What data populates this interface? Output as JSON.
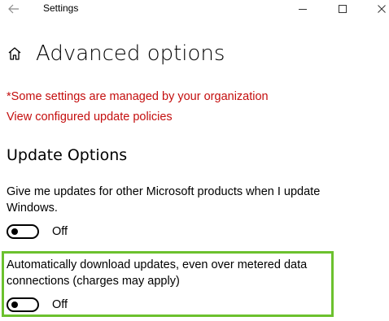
{
  "window": {
    "title": "Settings",
    "back_icon": "back-arrow-icon",
    "controls": [
      "minimize-icon",
      "maximize-icon",
      "close-icon"
    ]
  },
  "page": {
    "title": "Advanced options",
    "home_icon": "home-icon"
  },
  "notices": {
    "org_warning": "*Some settings are managed by your organization",
    "policies_link": "View configured update policies",
    "color": "#c40e0e"
  },
  "update_options": {
    "heading": "Update Options",
    "options": [
      {
        "text": "Give me updates for other Microsoft products when I update Windows.",
        "toggle_state": "Off",
        "enabled": false
      },
      {
        "text": "Automatically download updates, even over metered data connections (charges may apply)",
        "toggle_state": "Off",
        "enabled": false
      }
    ]
  },
  "annotation": {
    "highlight_color": "#6cc12e"
  }
}
